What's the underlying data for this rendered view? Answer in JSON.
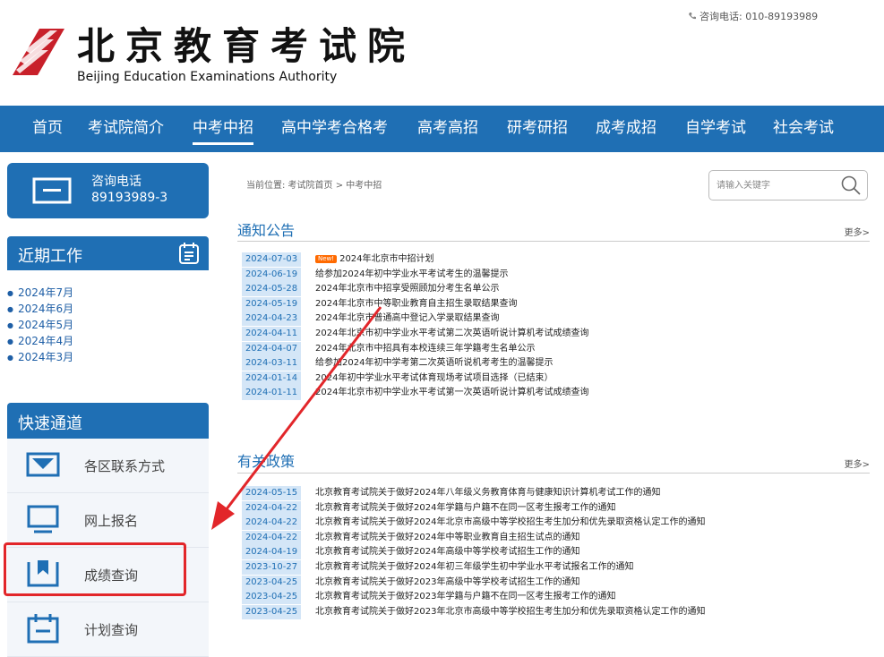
{
  "header": {
    "phone_label": "咨询电话: 010-89193989",
    "logo_cn": "北京教育考试院",
    "logo_en": "Beijing Education Examinations Authority",
    "brand_color": "#1f6fb4"
  },
  "nav": {
    "items": [
      "首页",
      "考试院简介",
      "中考中招",
      "高中学考合格考",
      "高考高招",
      "研考研招",
      "成考成招",
      "自学考试",
      "社会考试"
    ],
    "active": "中考中招"
  },
  "sidebar": {
    "consult_title": "咨询电话",
    "consult_number": "89193989-3",
    "recent_title": "近期工作",
    "recent_items": [
      "2024年7月",
      "2024年6月",
      "2024年5月",
      "2024年4月",
      "2024年3月"
    ],
    "quick_title": "快速通道",
    "quick_items": [
      {
        "label": "各区联系方式",
        "icon": "envelope-icon"
      },
      {
        "label": "网上报名",
        "icon": "monitor-icon"
      },
      {
        "label": "成绩查询",
        "icon": "bookmark-icon",
        "highlighted": true
      },
      {
        "label": "计划查询",
        "icon": "calendar-icon"
      }
    ],
    "highlight_color": "#e2262a"
  },
  "main": {
    "breadcrumb": "当前位置: 考试院首页 > 中考中招",
    "search_placeholder": "请输入关键字",
    "notices_title": "通知公告",
    "notices_more": "更多>",
    "notices": [
      {
        "date": "2024-07-03",
        "title": "2024年北京市中招计划",
        "new": true,
        "new_label": "New!"
      },
      {
        "date": "2024-06-19",
        "title": "给参加2024年初中学业水平考试考生的温馨提示"
      },
      {
        "date": "2024-05-28",
        "title": "2024年北京市中招享受照顾加分考生名单公示"
      },
      {
        "date": "2024-05-19",
        "title": "2024年北京市中等职业教育自主招生录取结果查询"
      },
      {
        "date": "2024-04-23",
        "title": "2024年北京市普通高中登记入学录取结果查询"
      },
      {
        "date": "2024-04-11",
        "title": "2024年北京市初中学业水平考试第二次英语听说计算机考试成绩查询"
      },
      {
        "date": "2024-04-07",
        "title": "2024年北京市中招具有本校连续三年学籍考生名单公示"
      },
      {
        "date": "2024-03-11",
        "title": "给参加2024年初中学考第二次英语听说机考考生的温馨提示"
      },
      {
        "date": "2024-01-14",
        "title": "2024年初中学业水平考试体育现场考试项目选择（已结束）"
      },
      {
        "date": "2024-01-11",
        "title": "2024年北京市初中学业水平考试第一次英语听说计算机考试成绩查询"
      }
    ],
    "policies_title": "有关政策",
    "policies_more": "更多>",
    "policies": [
      {
        "date": "2024-05-15",
        "title": "北京教育考试院关于做好2024年八年级义务教育体育与健康知识计算机考试工作的通知"
      },
      {
        "date": "2024-04-22",
        "title": "北京教育考试院关于做好2024年学籍与户籍不在同一区考生报考工作的通知"
      },
      {
        "date": "2024-04-22",
        "title": "北京教育考试院关于做好2024年北京市高级中等学校招生考生加分和优先录取资格认定工作的通知"
      },
      {
        "date": "2024-04-22",
        "title": "北京教育考试院关于做好2024年中等职业教育自主招生试点的通知"
      },
      {
        "date": "2024-04-19",
        "title": "北京教育考试院关于做好2024年高级中等学校考试招生工作的通知"
      },
      {
        "date": "2023-10-27",
        "title": "北京教育考试院关于做好2024年初三年级学生初中学业水平考试报名工作的通知"
      },
      {
        "date": "2023-04-25",
        "title": "北京教育考试院关于做好2023年高级中等学校考试招生工作的通知"
      },
      {
        "date": "2023-04-25",
        "title": "北京教育考试院关于做好2023年学籍与户籍不在同一区考生报考工作的通知"
      },
      {
        "date": "2023-04-25",
        "title": "北京教育考试院关于做好2023年北京市高级中等学校招生考生加分和优先录取资格认定工作的通知"
      }
    ]
  },
  "annotation": {
    "arrow_color": "#e2262a"
  }
}
